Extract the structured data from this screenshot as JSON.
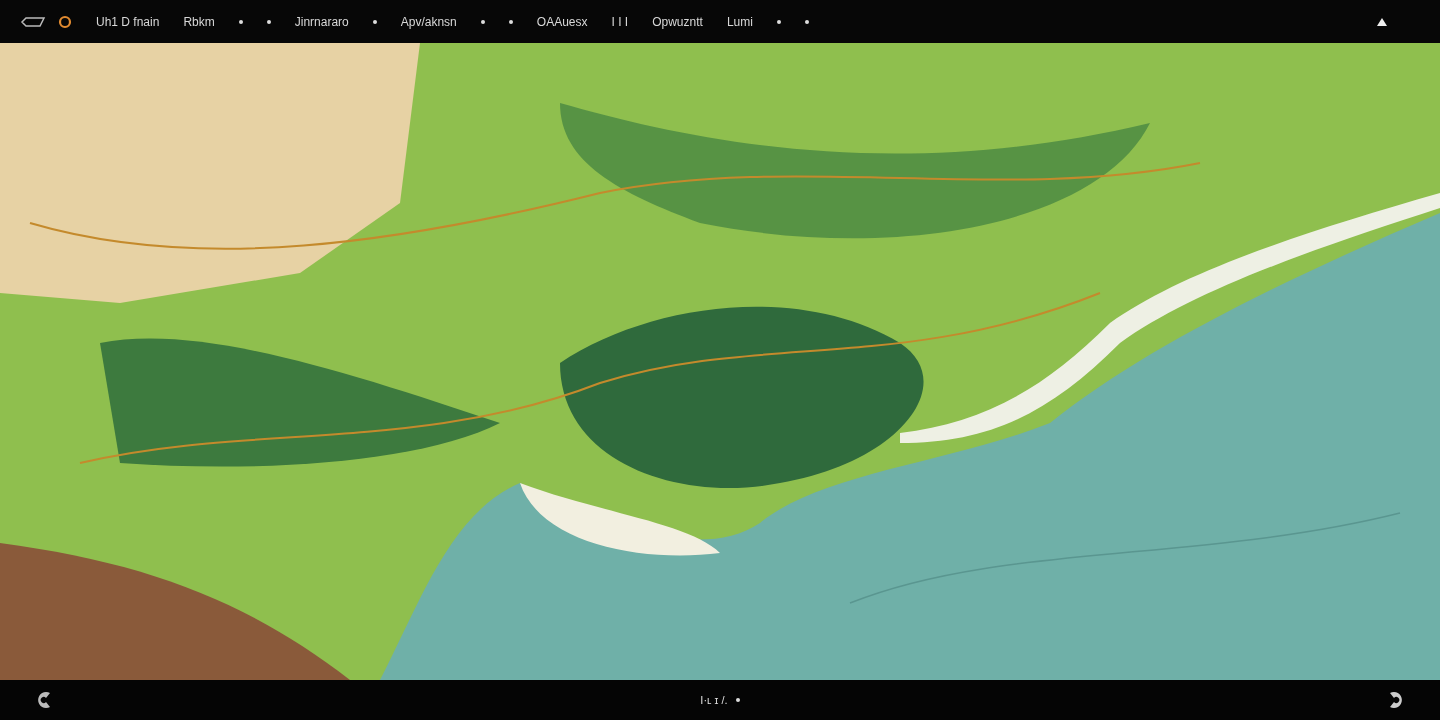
{
  "top_bar": {
    "items": [
      {
        "kind": "link",
        "text": "Uh1 D fnain"
      },
      {
        "kind": "link",
        "text": "Rbkm"
      },
      {
        "kind": "dot"
      },
      {
        "kind": "dot"
      },
      {
        "kind": "link",
        "text": "Jinrnararo"
      },
      {
        "kind": "dot"
      },
      {
        "kind": "link",
        "text": "Apv/aknsn"
      },
      {
        "kind": "dot"
      },
      {
        "kind": "dot"
      },
      {
        "kind": "link",
        "text": "OAAuesx"
      },
      {
        "kind": "link",
        "text": "I I I"
      },
      {
        "kind": "link",
        "text": "Opwuzntt"
      },
      {
        "kind": "link",
        "text": "Lumi"
      },
      {
        "kind": "dot"
      },
      {
        "kind": "dot"
      }
    ]
  },
  "bottom_bar": {
    "page_indicator": "I·ʟ ɪ /."
  }
}
